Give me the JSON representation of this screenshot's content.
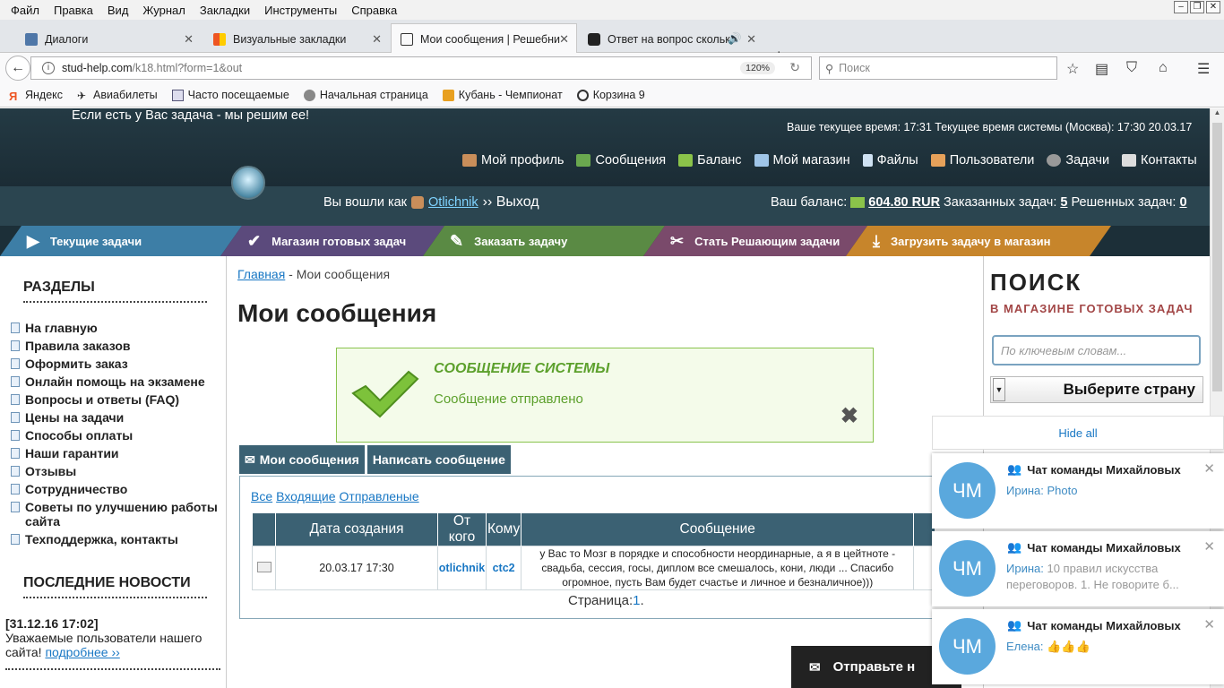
{
  "menubar": [
    "Файл",
    "Правка",
    "Вид",
    "Журнал",
    "Закладки",
    "Инструменты",
    "Справка"
  ],
  "tabs": [
    {
      "label": "Диалоги",
      "active": false
    },
    {
      "label": "Визуальные закладки",
      "active": false
    },
    {
      "label": "Мои сообщения | Решебни",
      "active": true
    },
    {
      "label": "Ответ на вопрос скольк",
      "active": false
    }
  ],
  "nav": {
    "url_host": "stud-help.com",
    "url_path": "/k18.html?form=1&out",
    "zoom": "120%",
    "search_placeholder": "Поиск"
  },
  "bookmarks": [
    "Яндекс",
    "Авиабилеты",
    "Часто посещаемые",
    "Начальная страница",
    "Кубань - Чемпионат",
    "Корзина 9"
  ],
  "header": {
    "slogan": "Если есть у Вас задача - мы решим ее!",
    "times": "Ваше текущее время: 17:31    Текущее время системы (Москва): 17:30 20.03.17",
    "nav": [
      "Мой профиль",
      "Сообщения",
      "Баланс",
      "Мой магазин",
      "Файлы",
      "Пользователи",
      "Задачи",
      "Контакты"
    ]
  },
  "userbar": {
    "logged_as": "Вы вошли как",
    "username": "Otlichnik",
    "exit": "›› Выход",
    "balance_label": "Ваш баланс:",
    "balance": "604.80 RUR",
    "ordered_label": "Заказанных задач:",
    "ordered": "5",
    "solved_label": "Решенных задач:",
    "solved": "0"
  },
  "page_tabs": [
    "Текущие задачи",
    "Магазин готовых задач",
    "Заказать задачу",
    "Стать Решающим задачи",
    "Загрузить задачу в магазин"
  ],
  "left": {
    "sections_title": "РАЗДЕЛЫ",
    "menu": [
      "На главную",
      "Правила заказов",
      "Оформить заказ",
      "Онлайн помощь на экзамене",
      "Вопросы и ответы (FAQ)",
      "Цены на задачи",
      "Способы оплаты",
      "Наши гарантии",
      "Отзывы",
      "Сотрудничество",
      "Советы по улучшению работы сайта",
      "Техподдержка, контакты"
    ],
    "news_title": "ПОСЛЕДНИЕ НОВОСТИ",
    "news_date": "[31.12.16 17:02]",
    "news_text": "Уважаемые пользователи нашего сайта!",
    "news_more": "подробнее ››"
  },
  "main": {
    "crumb_home": "Главная",
    "crumb_current": " - Мои сообщения",
    "title": "Мои сообщения",
    "sys_head": "СООБЩЕНИЕ СИСТЕМЫ",
    "sys_text": "Сообщение отправлено",
    "tab_my": "Мои сообщения",
    "tab_write": "Написать сообщение",
    "filter_all": "Все",
    "filter_in": "Входящие",
    "filter_out": "Отправленые",
    "columns": [
      "Дата создания",
      "От кого",
      "Кому",
      "Сообщение"
    ],
    "row": {
      "date": "20.03.17 17:30",
      "from": "otlichnik",
      "to": "ctc2",
      "message": "у Вас то Мозг в порядке и способности неординарные, а я в цейтноте - свадьба, сессия, госы, диплом все смешалось, кони, люди ... Спасибо огромное, пусть Вам будет счастье и личное и безналичное)))"
    },
    "pager_label": "Страница:",
    "pager_page": "1",
    "pager_end": "."
  },
  "right": {
    "search_title": "ПОИСК",
    "search_sub": "В МАГАЗИНЕ ГОТОВЫХ ЗАДАЧ",
    "kw_placeholder": "По ключевым словам...",
    "country": "Выберите страну"
  },
  "sendbar": "Отправьте н",
  "notifications": {
    "hide_all": "Hide all",
    "items": [
      {
        "avatar": "ЧМ",
        "title": "Чат команды Михайловых",
        "who": "Ирина:",
        "text": " Photo",
        "grey": ""
      },
      {
        "avatar": "ЧМ",
        "title": "Чат команды Михайловых",
        "who": "Ирина:",
        "text": "",
        "grey": " 10 правил искусства переговоров.   1. Не говорите б..."
      },
      {
        "avatar": "ЧМ",
        "title": "Чат команды Михайловых",
        "who": "Елена:",
        "text": " 👍👍👍",
        "grey": ""
      }
    ]
  },
  "colors": {
    "tab1": "#3d7ea6",
    "tab2": "#5b4a7c",
    "tab3": "#5a8a44",
    "tab4": "#7a4a6b",
    "tab5": "#c7852b",
    "accent": "#1877c4"
  }
}
